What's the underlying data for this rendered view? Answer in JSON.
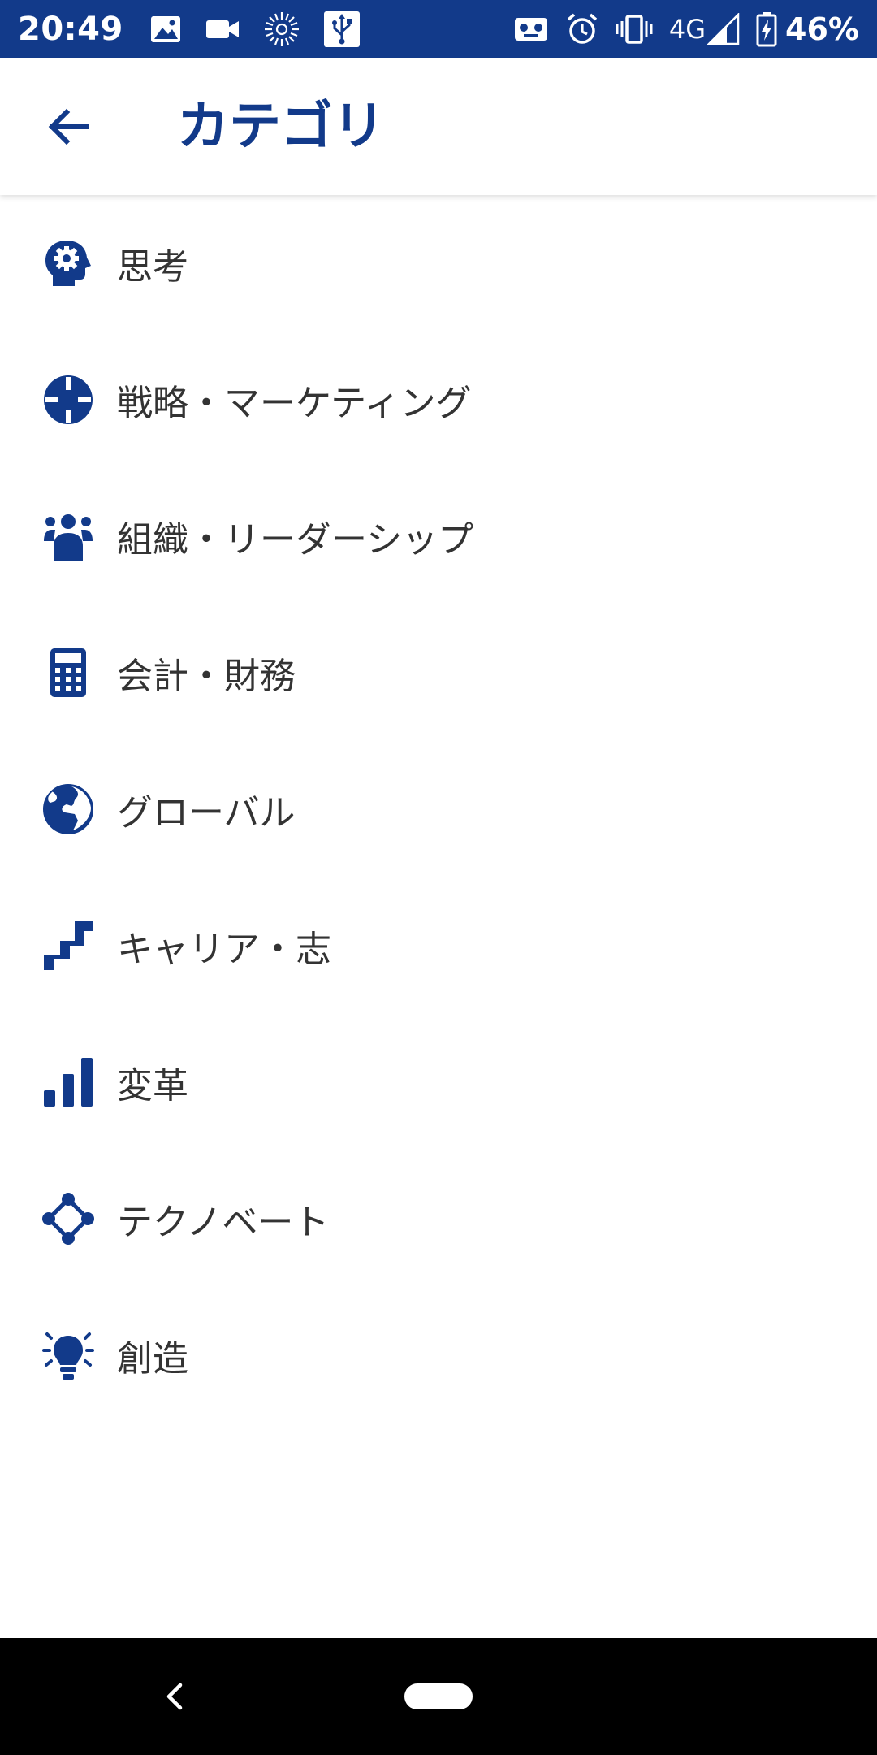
{
  "status_bar": {
    "time": "20:49",
    "left_icons": [
      "image-icon",
      "video-camera-icon",
      "sunburst-icon",
      "usb-icon"
    ],
    "network": "4G",
    "battery": "46%",
    "right_icons": [
      "voicemail-icon",
      "alarm-icon",
      "vibrate-icon",
      "signal-icon",
      "battery-charging-icon"
    ]
  },
  "app_bar": {
    "title": "カテゴリ",
    "back_icon": "arrow-left-icon"
  },
  "categories": [
    {
      "label": "思考",
      "icon": "head-gear-icon"
    },
    {
      "label": "戦略・マーケティング",
      "icon": "crosshair-icon"
    },
    {
      "label": "組織・リーダーシップ",
      "icon": "group-icon"
    },
    {
      "label": "会計・財務",
      "icon": "calculator-icon"
    },
    {
      "label": "グローバル",
      "icon": "globe-icon"
    },
    {
      "label": "キャリア・志",
      "icon": "stairs-icon"
    },
    {
      "label": "変革",
      "icon": "bar-chart-icon"
    },
    {
      "label": "テクノベート",
      "icon": "network-nodes-icon"
    },
    {
      "label": "創造",
      "icon": "lightbulb-icon"
    }
  ],
  "colors": {
    "primary": "#123a8a",
    "text": "#333333",
    "background": "#ffffff",
    "nav_bar": "#000000"
  }
}
